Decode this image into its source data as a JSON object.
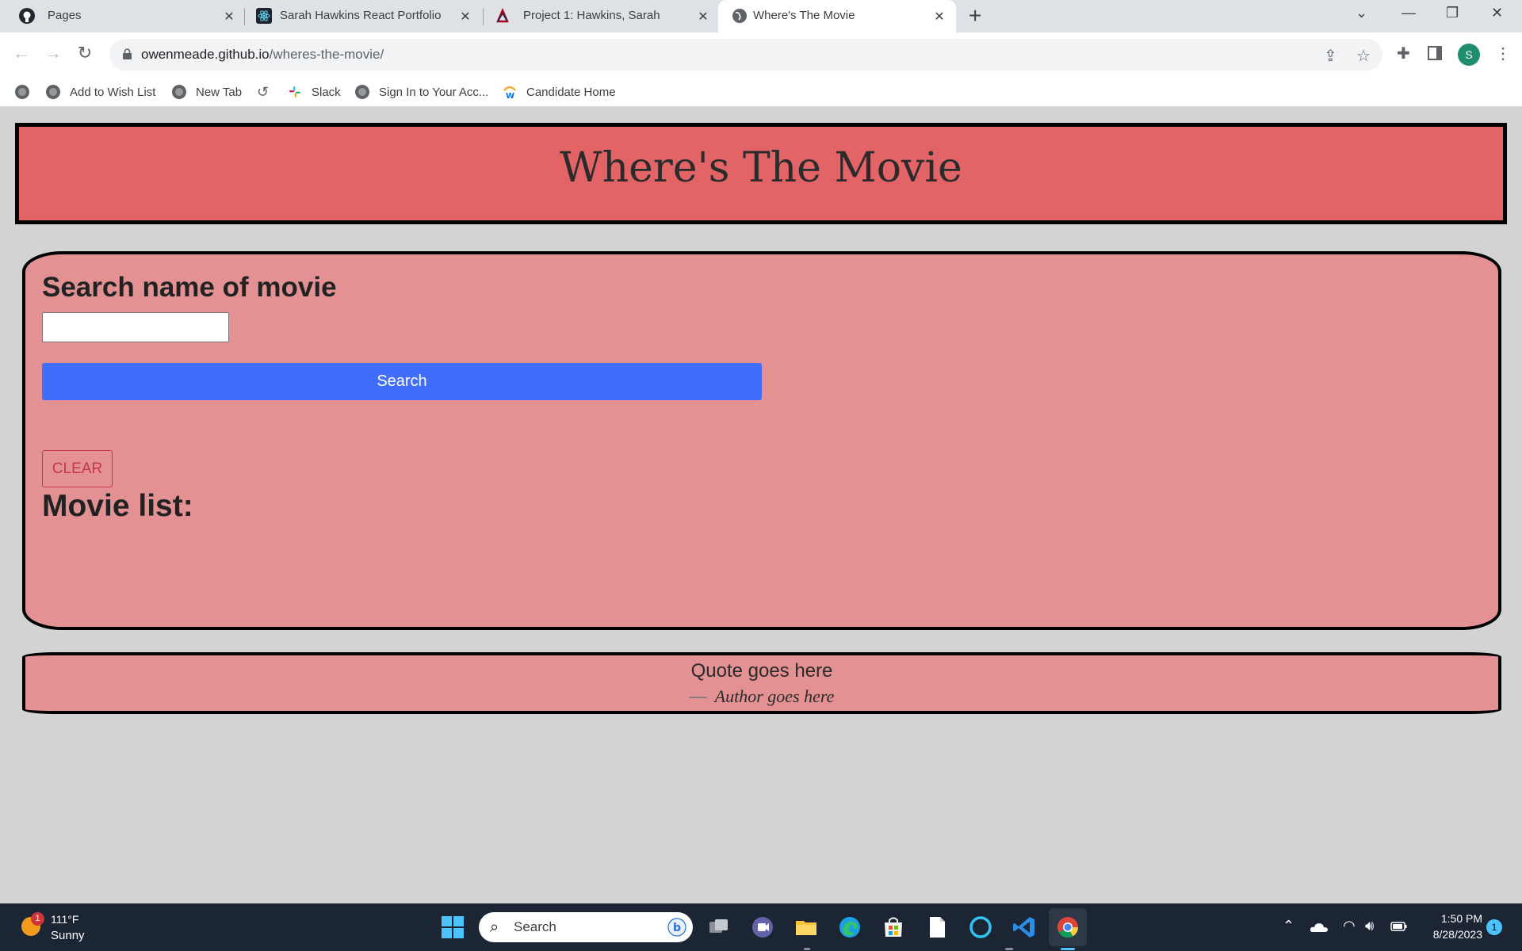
{
  "browser": {
    "tabs": [
      {
        "title": "Pages",
        "icon": "github-icon"
      },
      {
        "title": "Sarah Hawkins React Portfolio",
        "icon": "react-icon"
      },
      {
        "title": "Project 1: Hawkins, Sarah",
        "icon": "university-logo-icon"
      },
      {
        "title": "Where's The Movie",
        "icon": "globe-icon",
        "active": true
      }
    ],
    "url_host": "owenmeade.github.io",
    "url_path": "/wheres-the-movie/",
    "profile_initial": "S",
    "bookmarks": [
      {
        "label": "",
        "icon": "globe-icon"
      },
      {
        "label": "Add to Wish List",
        "icon": "globe-icon"
      },
      {
        "label": "New Tab",
        "icon": "globe-icon"
      },
      {
        "label": "",
        "icon": "history-icon"
      },
      {
        "label": "Slack",
        "icon": "slack-icon"
      },
      {
        "label": "Sign In to Your Acc...",
        "icon": "globe-icon"
      },
      {
        "label": "Candidate Home",
        "icon": "workday-icon"
      }
    ]
  },
  "page": {
    "title": "Where's The Movie",
    "search_heading": "Search name of movie",
    "search_value": "",
    "search_button": "Search",
    "clear_button": "CLEAR",
    "list_heading": "Movie list:",
    "quote": "Quote goes here",
    "quote_dash": "—",
    "author": "Author goes here"
  },
  "taskbar": {
    "weather_temp": "111°F",
    "weather_condition": "Sunny",
    "weather_badge": "1",
    "search_label": "Search",
    "time": "1:50 PM",
    "date": "8/28/2023",
    "notification_count": "1"
  },
  "colors": {
    "hero_bg": "#e36467",
    "panel_bg": "#e39193",
    "search_button": "#416dfb",
    "clear_button": "#c6364b",
    "page_bg": "#d3d3d3"
  }
}
